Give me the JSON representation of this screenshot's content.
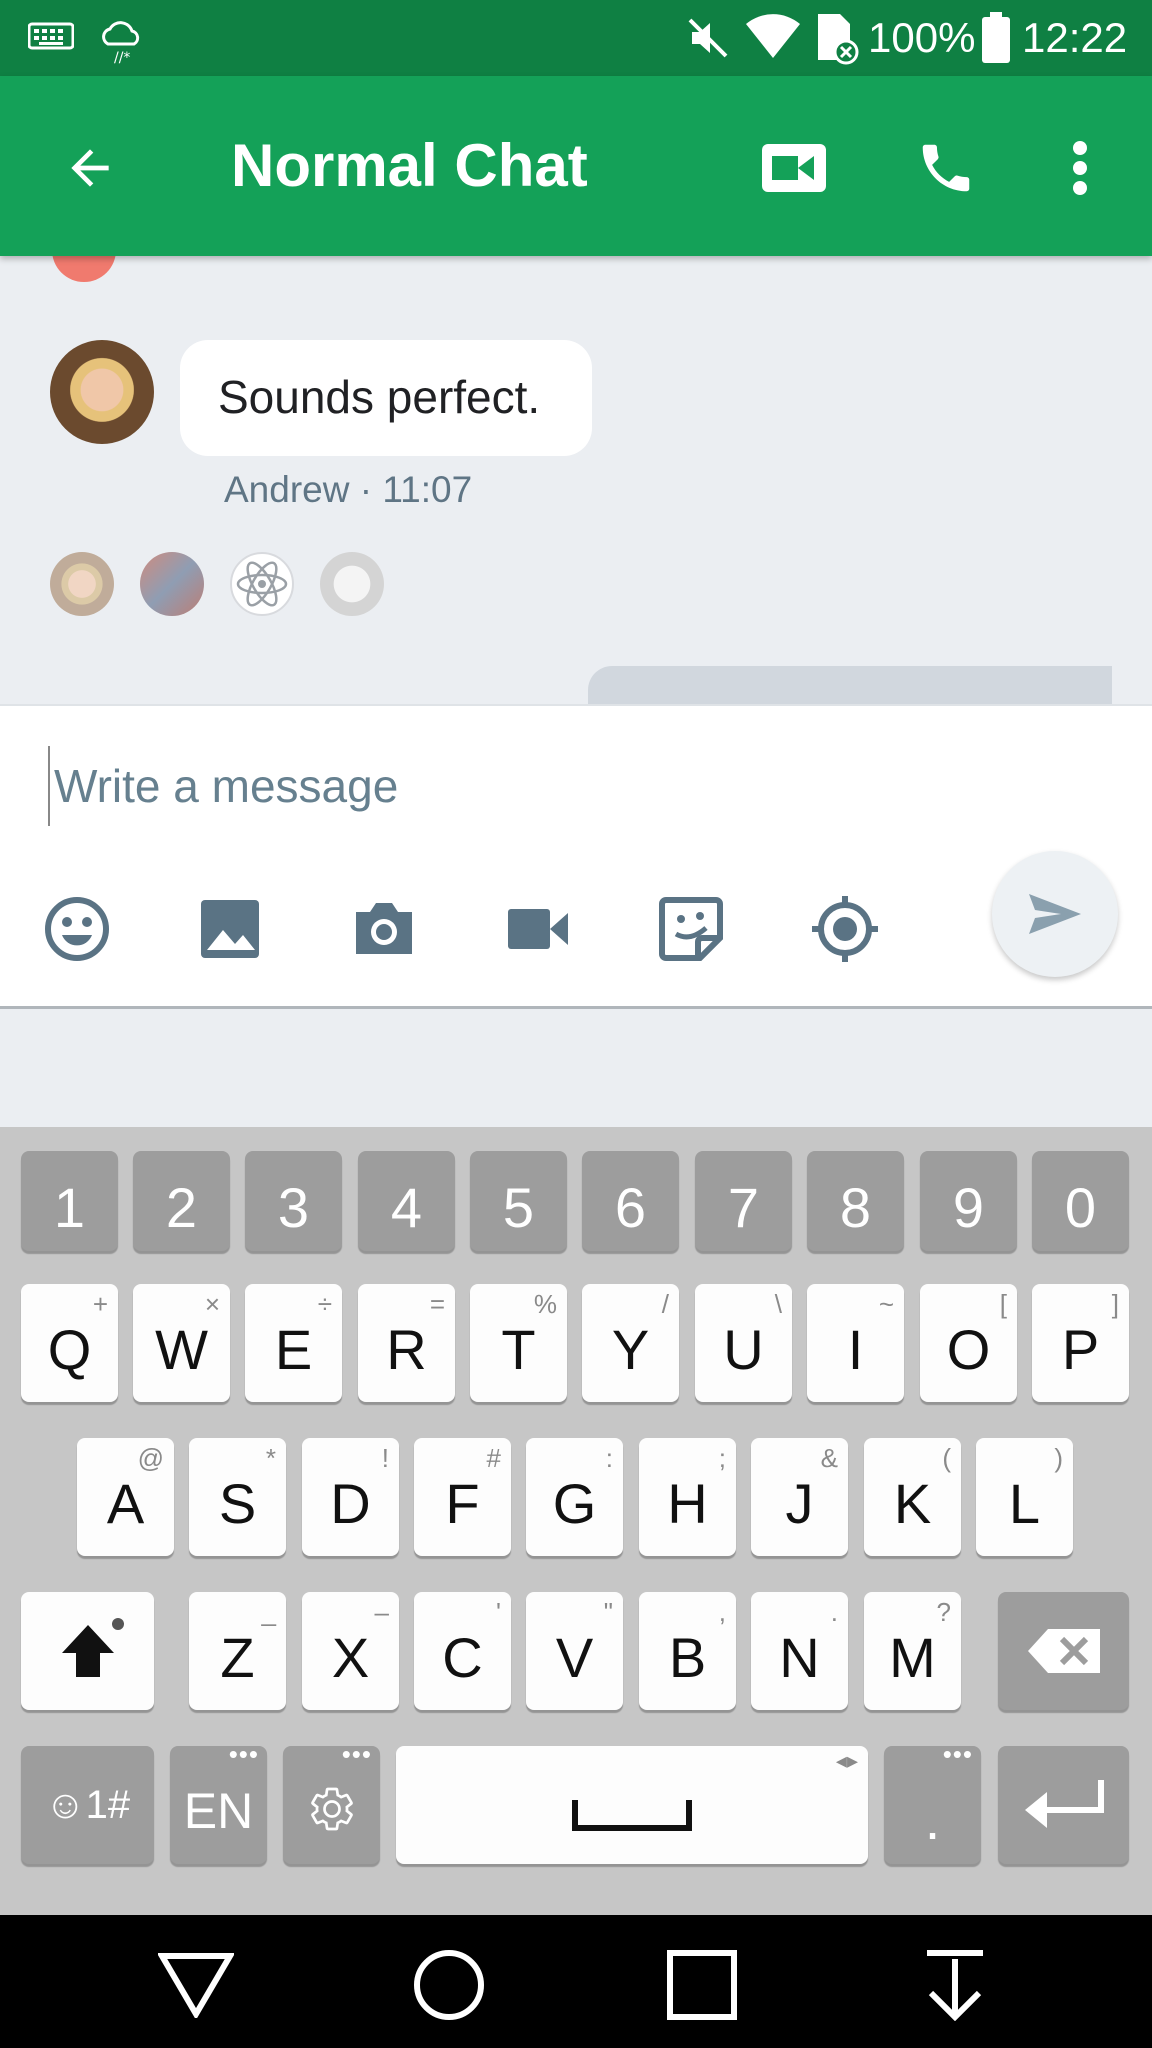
{
  "status_bar": {
    "battery": "100%",
    "time": "12:22"
  },
  "app_bar": {
    "title": "Normal Chat"
  },
  "chat": {
    "messages": [
      {
        "text": "Sounds perfect.",
        "sender": "Andrew",
        "time": "11:07",
        "meta": "Andrew · 11:07"
      }
    ],
    "read_receipts": [
      "avatar-1",
      "avatar-2",
      "atom-avatar",
      "avatar-4"
    ]
  },
  "composer": {
    "placeholder": "Write a message",
    "tools": [
      "emoji-icon",
      "gallery-icon",
      "camera-icon",
      "video-icon",
      "sticker-icon",
      "location-icon"
    ]
  },
  "keyboard": {
    "number_row": [
      "1",
      "2",
      "3",
      "4",
      "5",
      "6",
      "7",
      "8",
      "9",
      "0"
    ],
    "row1": [
      {
        "key": "Q",
        "sub": "+"
      },
      {
        "key": "W",
        "sub": "×"
      },
      {
        "key": "E",
        "sub": "÷"
      },
      {
        "key": "R",
        "sub": "="
      },
      {
        "key": "T",
        "sub": "%"
      },
      {
        "key": "Y",
        "sub": "/"
      },
      {
        "key": "U",
        "sub": "\\"
      },
      {
        "key": "I",
        "sub": "~"
      },
      {
        "key": "O",
        "sub": "["
      },
      {
        "key": "P",
        "sub": "]"
      }
    ],
    "row2": [
      {
        "key": "A",
        "sub": "@"
      },
      {
        "key": "S",
        "sub": "*"
      },
      {
        "key": "D",
        "sub": "!"
      },
      {
        "key": "F",
        "sub": "#"
      },
      {
        "key": "G",
        "sub": ":"
      },
      {
        "key": "H",
        "sub": ";"
      },
      {
        "key": "J",
        "sub": "&"
      },
      {
        "key": "K",
        "sub": "("
      },
      {
        "key": "L",
        "sub": ")"
      }
    ],
    "row3": [
      {
        "key": "Z",
        "sub": "_"
      },
      {
        "key": "X",
        "sub": "–"
      },
      {
        "key": "C",
        "sub": "'"
      },
      {
        "key": "V",
        "sub": "\""
      },
      {
        "key": "B",
        "sub": ","
      },
      {
        "key": "N",
        "sub": "."
      },
      {
        "key": "M",
        "sub": "?"
      }
    ],
    "symbols_label": "☺1#",
    "language_label": "EN",
    "period_label": "."
  }
}
